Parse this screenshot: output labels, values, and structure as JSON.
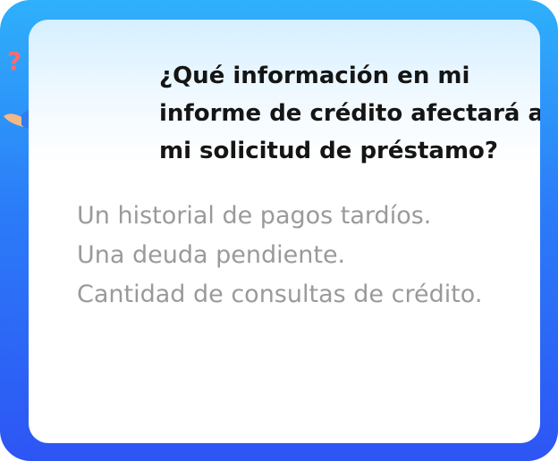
{
  "question": {
    "text": "¿Qué información en mi informe de crédito afectará a mi solicitud de préstamo?"
  },
  "answers": [
    "Un historial de pagos tardíos.",
    "Una deuda pendiente.",
    "Cantidad de consultas de crédito."
  ],
  "icons": {
    "mascot": "confused-person-icon",
    "question_marks": "question-mark-icon"
  },
  "colors": {
    "frame_top": "#2fb0fb",
    "frame_bottom": "#2d55f4",
    "question_text": "#151515",
    "answer_text": "#9a9a9a",
    "question_mark": "#ff6b6b"
  }
}
